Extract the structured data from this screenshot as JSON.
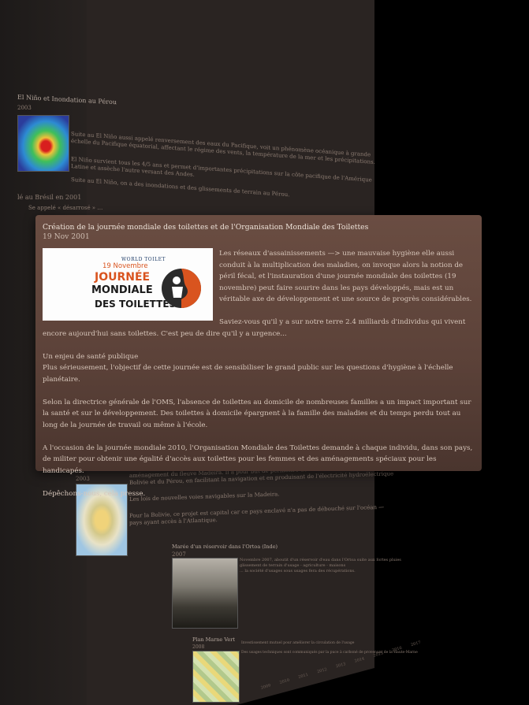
{
  "background": {
    "article1": {
      "title": "El Niño et Inondation au Pérou",
      "date": "2003",
      "lines": [
        "Suite au El Niño aussi appelé renversement des eaux du Pacifique, voit un phénomène océanique à grande",
        "échelle du Pacifique équatorial, affectant le régime des vents, la température de la mer et les précipitations.",
        "El Niño survient tous les 4/5 ans et permet d'importantes précipitations sur la côte pacifique de l'Amérique",
        "Latine et assèche l'autre versant des Andes.",
        "Suite au El Niño, on a des inondations et des glissements de terrain au Pérou."
      ],
      "side1": "lé au Brésil en 2001",
      "side2": "Se appelé « désarrosé » …"
    },
    "article2": {
      "date": "2003",
      "lines": [
        "aménagement du fleuve Madeira. Il a pour but de permettre de rendre le fleuve navigable sur l'ensemble de son cours",
        "Bolivie et du Pérou, en facilitant la navigation et en produisant de l'électricité hydroélectrique",
        "Les lois de nouvelles voies navigables sur la Madeira.",
        "Pour la Bolivie, ce projet est capital car ce pays enclavé n'a pas de débouché sur l'océan —",
        "pays ayant accès à l'Atlantique."
      ]
    },
    "article3": {
      "title": "Marée d'un réservoir dans l'Ortoa (Inde)",
      "date": "2007",
      "lines": [
        "Novembre 2007, aboutit d'un réservoir d'eau dans l'Ortoa suite aux fortes pluies",
        "glissement de terrain d'usage - agriculture - maisons",
        "... la société d'usages sous usages fera des récupérations."
      ]
    },
    "article4": {
      "title": "Plan Marne Vert",
      "date": "2008",
      "lines": [
        "Investissement mutuel pour améliorer la circulation de l'usage",
        "Des usages techniques sont communiqués par la puce à carboné de provenant de la Haute-Marne"
      ]
    },
    "timeline_years": [
      "2009",
      "2010",
      "2011",
      "2012",
      "2013",
      "2014",
      "2015",
      "2016",
      "2017"
    ]
  },
  "modal": {
    "title": "Création de la journée mondiale des toilettes et de l'Organisation Mondiale des Toilettes",
    "date": "19 Nov 2001",
    "logo": {
      "brand": "WORLD TOILET",
      "date": "19 Novembre",
      "line1": "JOURNÉE",
      "line2": "MONDIALE",
      "line3": "DES TOILETTES"
    },
    "paragraphs": [
      "Les réseaux d'assainissements —> une mauvaise hygiène elle aussi conduit à la multiplication des maladies, on invoque alors la notion de péril fécal, et l'instauration d'une journée mondiale des toilettes (19 novembre) peut faire sourire dans les pays développés, mais est un véritable axe de développement et une source de progrès considérables.",
      "Saviez-vous qu'il y a sur notre terre 2.4 milliards d'individus qui vivent encore aujourd'hui sans toilettes. C'est peu de dire qu'il y a urgence...",
      "Un enjeu de santé publique",
      "Plus sérieusement, l'objectif de cette journée est de sensibiliser le grand public sur les questions d'hygiène à l'échelle planétaire.",
      "Selon la directrice générale de l'OMS, l'absence de toilettes au domicile de nombreuses familles a un impact important sur la santé et sur le développement. Des toilettes à domicile épargnent à la famille des maladies et du temps perdu tout au long de la journée de travail ou même à l'école.",
      "A l'occasion de la journée mondiale 2010, l'Organisation Mondiale des Toilettes demande à chaque individu, dans son pays, de militer pour obtenir une égalité d'accès aux toilettes pour les femmes et des aménagements spéciaux pour les handicapés.",
      "Dépêchons-nous, cela presse."
    ]
  }
}
